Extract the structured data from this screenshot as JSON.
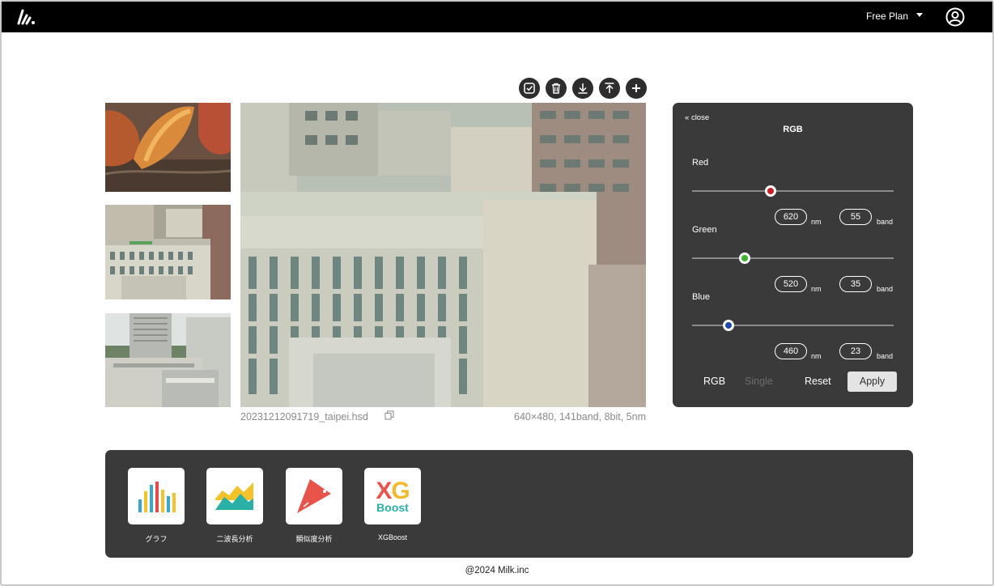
{
  "header": {
    "plan_label": "Free Plan",
    "logo_icon": "milk-logo-icon",
    "account_icon": "account-circle-icon"
  },
  "toolbar": {
    "icons": [
      "select-all-icon",
      "trash-icon",
      "download-icon",
      "upload-icon",
      "add-icon"
    ]
  },
  "viewer": {
    "filename": "20231212091719_taipei.hsd",
    "meta": "640×480, 141band, 8bit, 5nm",
    "thumbnails": [
      "bananas",
      "building-street",
      "city-skyline"
    ]
  },
  "rgb_panel": {
    "close_label": "close",
    "title": "RGB",
    "channels": [
      {
        "name": "Red",
        "nm": "620",
        "band": "55",
        "color": "#c8202a",
        "position": 0.39
      },
      {
        "name": "Green",
        "nm": "520",
        "band": "35",
        "color": "#3bb52c",
        "position": 0.26
      },
      {
        "name": "Blue",
        "nm": "460",
        "band": "23",
        "color": "#1d47a8",
        "position": 0.18
      }
    ],
    "unit_nm": "nm",
    "unit_band": "band",
    "mode_rgb": "RGB",
    "mode_single": "Single",
    "reset_label": "Reset",
    "apply_label": "Apply"
  },
  "apps": [
    {
      "label": "グラフ",
      "icon": "bar-chart-icon"
    },
    {
      "label": "二波長分析",
      "icon": "area-chart-icon"
    },
    {
      "label": "類似度分析",
      "icon": "similarity-pennant-icon"
    },
    {
      "label": "XGBoost",
      "icon": "xgboost-logo-icon",
      "logo_text_top": "XG",
      "logo_text_bottom": "Boost"
    }
  ],
  "footer": {
    "text": "@2024 Milk.inc"
  }
}
